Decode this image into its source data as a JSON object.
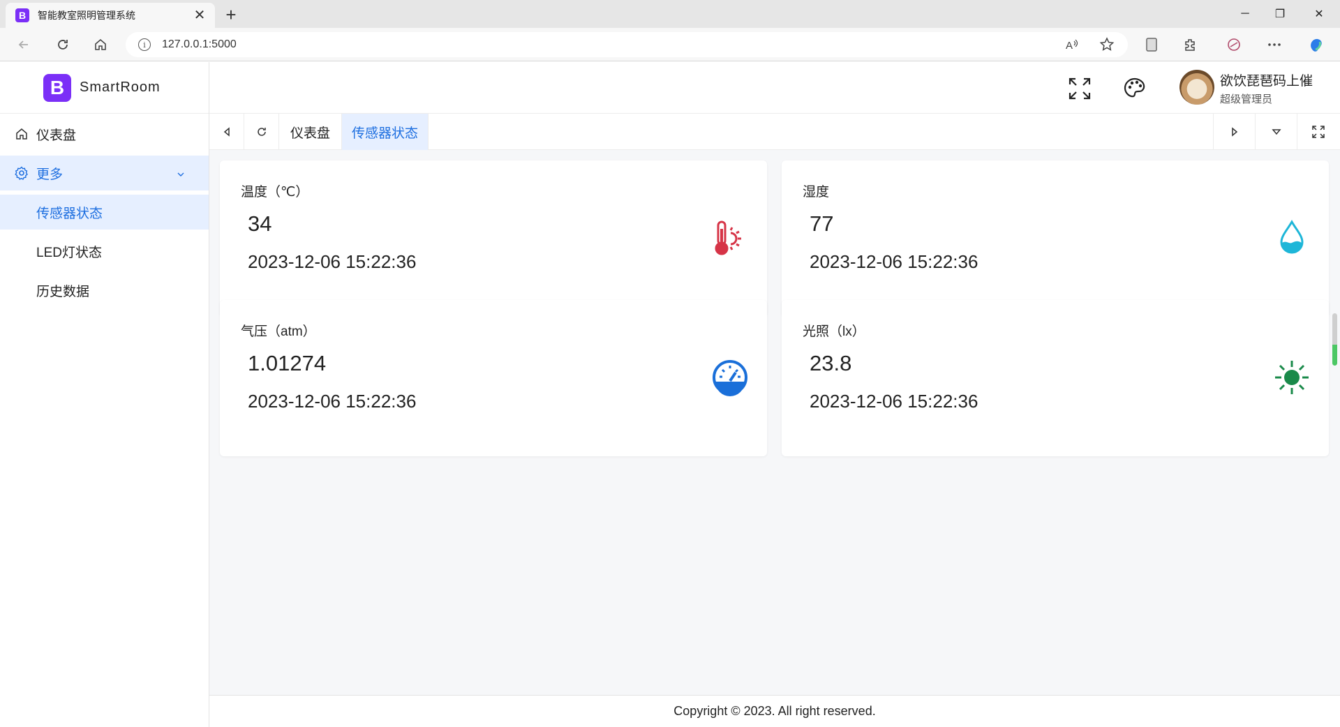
{
  "browser": {
    "tab_title": "智能教室照明管理系统",
    "tab_favicon_letter": "B",
    "close_label": "✕",
    "newtab_label": "+",
    "url": "127.0.0.1:5000",
    "win_min": "─",
    "win_max": "❐",
    "win_close": "✕"
  },
  "app": {
    "brand_letter": "B",
    "brand_name": "SmartRoom",
    "accent": "#1e6fe0",
    "brand_color": "#7b2ff7"
  },
  "sidebar": {
    "items": [
      {
        "label": "仪表盘",
        "icon": "home-icon"
      },
      {
        "label": "更多",
        "icon": "gear-icon",
        "expanded": true
      },
      {
        "label": "传感器状态",
        "active": true
      },
      {
        "label": "LED灯状态"
      },
      {
        "label": "历史数据"
      }
    ]
  },
  "header": {
    "user_name": "欲饮琵琶码上催",
    "user_role": "超级管理员"
  },
  "tabs": [
    {
      "label": "仪表盘"
    },
    {
      "label": "传感器状态",
      "active": true
    }
  ],
  "sensors": [
    {
      "label": "温度（℃）",
      "value": "34",
      "time": "2023-12-06 15:22:36",
      "icon": "thermometer-icon",
      "color": "#d63447"
    },
    {
      "label": "湿度",
      "value": "77",
      "time": "2023-12-06 15:22:36",
      "icon": "water-drop-icon",
      "color": "#1eb6d8"
    },
    {
      "label": "气压（atm）",
      "value": "1.01274",
      "time": "2023-12-06 15:22:36",
      "icon": "gauge-icon",
      "color": "#1a6fd9"
    },
    {
      "label": "光照（lx）",
      "value": "23.8",
      "time": "2023-12-06 15:22:36",
      "icon": "sun-icon",
      "color": "#1a8a4a"
    }
  ],
  "footer": {
    "text": "Copyright © 2023. All right reserved."
  }
}
